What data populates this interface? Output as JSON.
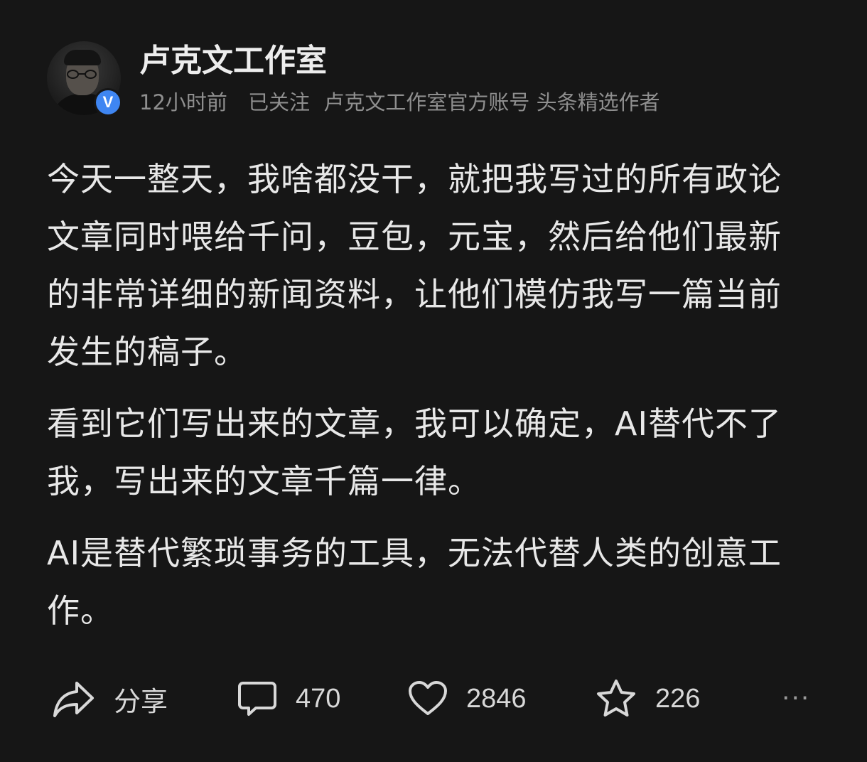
{
  "author": {
    "name": "卢克文工作室",
    "verified_badge": "V",
    "time": "12小时前",
    "follow_status": "已关注",
    "description": "卢克文工作室官方账号 头条精选作者"
  },
  "post": {
    "paragraphs": [
      "今天一整天，我啥都没干，就把我写过的所有政论文章同时喂给千问，豆包，元宝，然后给他们最新的非常详细的新闻资料，让他们模仿我写一篇当前发生的稿子。",
      "看到它们写出来的文章，我可以确定，AI替代不了我，写出来的文章千篇一律。",
      "AI是替代繁琐事务的工具，无法代替人类的创意工作。"
    ]
  },
  "actions": {
    "share_label": "分享",
    "comment_count": "470",
    "like_count": "2846",
    "favorite_count": "226",
    "more_label": "···"
  },
  "colors": {
    "background": "#161616",
    "text_primary": "#e8e8e8",
    "text_secondary": "#8f8f8f",
    "verified_blue": "#3f86f2"
  },
  "icons": [
    "share-icon",
    "comment-icon",
    "heart-icon",
    "star-icon",
    "more-icon",
    "verified-icon"
  ]
}
